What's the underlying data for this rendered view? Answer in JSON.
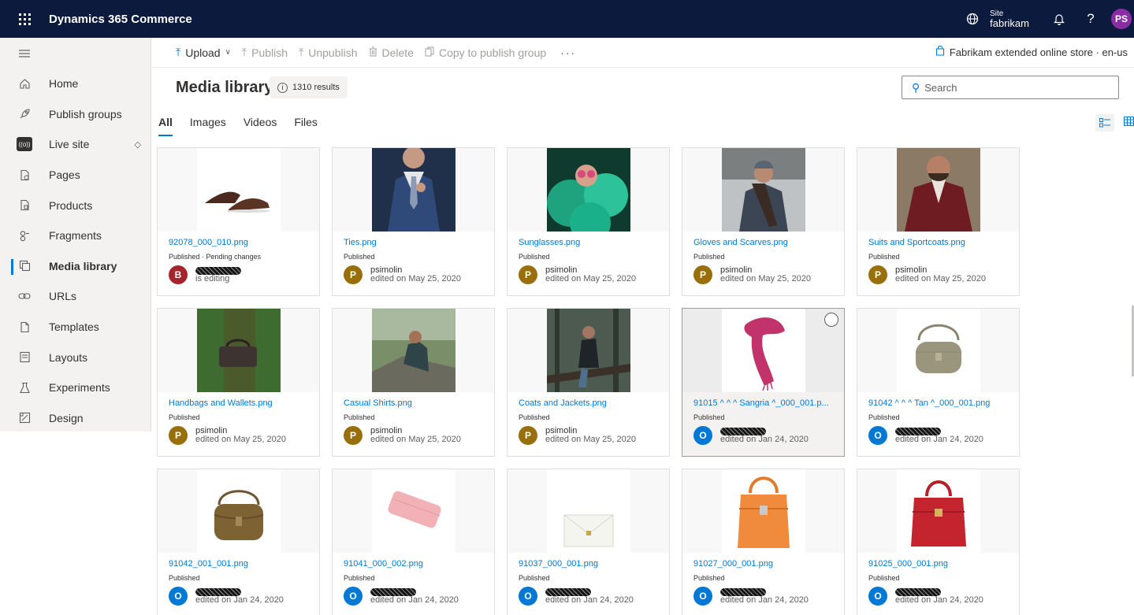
{
  "app": {
    "title": "Dynamics 365 Commerce",
    "site_label": "Site",
    "site_value": "fabrikam",
    "user_initials": "PS",
    "accent": "#0078d4",
    "topbar_color": "#0b1a3d"
  },
  "sidebar": {
    "items": [
      {
        "label": "Home",
        "icon": "home-icon"
      },
      {
        "label": "Publish groups",
        "icon": "rocket-icon"
      },
      {
        "label": "Live site",
        "icon": "live-site-icon"
      },
      {
        "label": "Pages",
        "icon": "pages-icon"
      },
      {
        "label": "Products",
        "icon": "products-icon"
      },
      {
        "label": "Fragments",
        "icon": "fragments-icon"
      },
      {
        "label": "Media library",
        "icon": "media-library-icon"
      },
      {
        "label": "URLs",
        "icon": "link-icon"
      },
      {
        "label": "Templates",
        "icon": "templates-icon"
      },
      {
        "label": "Layouts",
        "icon": "layouts-icon"
      },
      {
        "label": "Experiments",
        "icon": "flask-icon"
      },
      {
        "label": "Design",
        "icon": "design-icon"
      }
    ],
    "live_badge": "((o))"
  },
  "toolbar": {
    "upload": "Upload",
    "publish": "Publish",
    "unpublish": "Unpublish",
    "delete": "Delete",
    "copy": "Copy to publish group",
    "more": "···",
    "store": "Fabrikam extended online store · en-us"
  },
  "header": {
    "title": "Media library",
    "results": "1310 results",
    "search_placeholder": "Search"
  },
  "tabs": [
    "All",
    "Images",
    "Videos",
    "Files"
  ],
  "media": [
    {
      "name": "92078_000_010.png",
      "status": "Published · Pending changes",
      "avatar": "B",
      "avatar_color": "#a4262c",
      "user": "",
      "edit": "is editing"
    },
    {
      "name": "Ties.png",
      "status": "Published",
      "avatar": "P",
      "avatar_color": "#986f0b",
      "user": "psimolin",
      "edit": "edited on May 25, 2020"
    },
    {
      "name": "Sunglasses.png",
      "status": "Published",
      "avatar": "P",
      "avatar_color": "#986f0b",
      "user": "psimolin",
      "edit": "edited on May 25, 2020"
    },
    {
      "name": "Gloves and Scarves.png",
      "status": "Published",
      "avatar": "P",
      "avatar_color": "#986f0b",
      "user": "psimolin",
      "edit": "edited on May 25, 2020"
    },
    {
      "name": "Suits and Sportcoats.png",
      "status": "Published",
      "avatar": "P",
      "avatar_color": "#986f0b",
      "user": "psimolin",
      "edit": "edited on May 25, 2020"
    },
    {
      "name": "Handbags and Wallets.png",
      "status": "Published",
      "avatar": "P",
      "avatar_color": "#986f0b",
      "user": "psimolin",
      "edit": "edited on May 25, 2020"
    },
    {
      "name": "Casual Shirts.png",
      "status": "Published",
      "avatar": "P",
      "avatar_color": "#986f0b",
      "user": "psimolin",
      "edit": "edited on May 25, 2020"
    },
    {
      "name": "Coats and Jackets.png",
      "status": "Published",
      "avatar": "P",
      "avatar_color": "#986f0b",
      "user": "psimolin",
      "edit": "edited on May 25, 2020"
    },
    {
      "name": "91015 ^ ^ ^ Sangria ^_000_001.p...",
      "status": "Published",
      "avatar": "O",
      "avatar_color": "#0078d4",
      "user": "",
      "edit": "edited on Jan 24, 2020"
    },
    {
      "name": "91042 ^ ^ ^ Tan ^_000_001.png",
      "status": "Published",
      "avatar": "O",
      "avatar_color": "#0078d4",
      "user": "",
      "edit": "edited on Jan 24, 2020"
    },
    {
      "name": "91042_001_001.png",
      "status": "Published",
      "avatar": "O",
      "avatar_color": "#0078d4",
      "user": "",
      "edit": "edited on Jan 24, 2020"
    },
    {
      "name": "91041_000_002.png",
      "status": "Published",
      "avatar": "O",
      "avatar_color": "#0078d4",
      "user": "",
      "edit": "edited on Jan 24, 2020"
    },
    {
      "name": "91037_000_001.png",
      "status": "Published",
      "avatar": "O",
      "avatar_color": "#0078d4",
      "user": "",
      "edit": "edited on Jan 24, 2020"
    },
    {
      "name": "91027_000_001.png",
      "status": "Published",
      "avatar": "O",
      "avatar_color": "#0078d4",
      "user": "",
      "edit": "edited on Jan 24, 2020"
    },
    {
      "name": "91025_000_001.png",
      "status": "Published",
      "avatar": "O",
      "avatar_color": "#0078d4",
      "user": "",
      "edit": "edited on Jan 24, 2020"
    }
  ]
}
